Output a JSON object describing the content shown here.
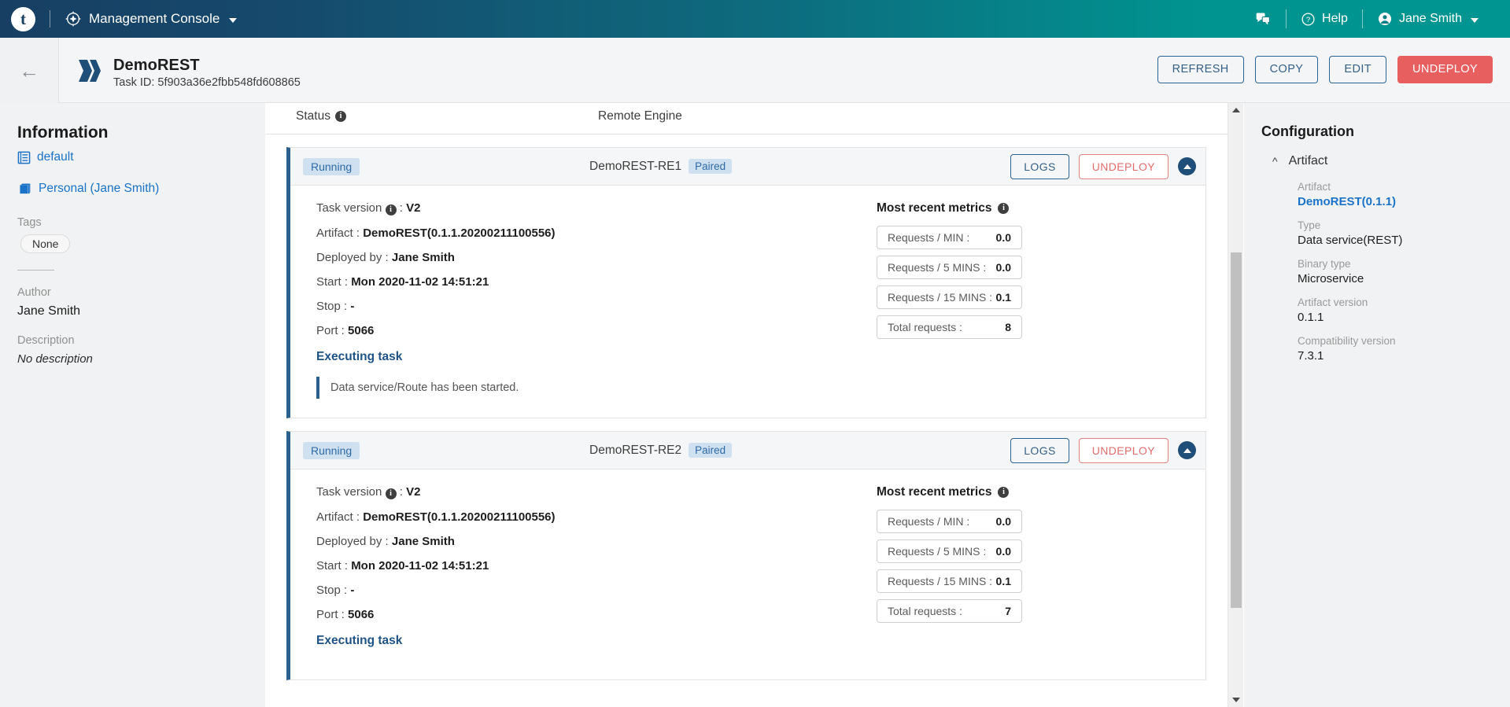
{
  "topbar": {
    "logo_letter": "t",
    "app_name": "Management Console",
    "app_icon": "compass-icon",
    "messages_icon": "chat-bubbles-icon",
    "help_icon": "question-circle-icon",
    "help_label": "Help",
    "user_icon": "user-avatar-icon",
    "user_name": "Jane Smith"
  },
  "pageheader": {
    "back_icon": "back-arrow-icon",
    "app_icon": "data-service-icon",
    "title": "DemoREST",
    "task_id": "Task ID: 5f903a36e2fbb548fd608865",
    "actions": {
      "refresh": "REFRESH",
      "copy": "COPY",
      "edit": "EDIT",
      "undeploy": "UNDEPLOY"
    }
  },
  "information": {
    "heading": "Information",
    "domain_icon": "list-document-icon",
    "domain": "default",
    "workspace_icon": "books-icon",
    "workspace": "Personal (Jane Smith)",
    "tags_label": "Tags",
    "tags_value": "None",
    "author_label": "Author",
    "author_value": "Jane Smith",
    "description_label": "Description",
    "description_value": "No description"
  },
  "table": {
    "col_status": "Status",
    "col_status_info_icon": "info-icon",
    "col_engine": "Remote Engine"
  },
  "cards": [
    {
      "status": "Running",
      "engine": "DemoREST-RE1",
      "pair_state": "Paired",
      "logs_label": "LOGS",
      "undeploy_label": "UNDEPLOY",
      "collapse_icon": "chevron-up-icon",
      "task_version_label": "Task version",
      "task_version_info_icon": "info-icon",
      "task_version_value": "V2",
      "artifact_label": "Artifact :",
      "artifact_value": "DemoREST(0.1.1.20200211100556)",
      "deployed_by_label": "Deployed by :",
      "deployed_by_value": "Jane Smith",
      "start_label": "Start :",
      "start_value": "Mon 2020-11-02 14:51:21",
      "stop_label": "Stop :",
      "stop_value": "-",
      "port_label": "Port :",
      "port_value": "5066",
      "executing_title": "Executing task",
      "executing_message": "Data service/Route has been started.",
      "metrics_title": "Most recent metrics",
      "metrics_info_icon": "info-icon",
      "metrics": [
        {
          "label": "Requests / MIN :",
          "value": "0.0"
        },
        {
          "label": "Requests / 5 MINS :",
          "value": "0.0"
        },
        {
          "label": "Requests / 15 MINS :",
          "value": "0.1"
        },
        {
          "label": "Total requests :",
          "value": "8"
        }
      ]
    },
    {
      "status": "Running",
      "engine": "DemoREST-RE2",
      "pair_state": "Paired",
      "logs_label": "LOGS",
      "undeploy_label": "UNDEPLOY",
      "collapse_icon": "chevron-up-icon",
      "task_version_label": "Task version",
      "task_version_info_icon": "info-icon",
      "task_version_value": "V2",
      "artifact_label": "Artifact :",
      "artifact_value": "DemoREST(0.1.1.20200211100556)",
      "deployed_by_label": "Deployed by :",
      "deployed_by_value": "Jane Smith",
      "start_label": "Start :",
      "start_value": "Mon 2020-11-02 14:51:21",
      "stop_label": "Stop :",
      "stop_value": "-",
      "port_label": "Port :",
      "port_value": "5066",
      "executing_title": "Executing task",
      "executing_message": "",
      "metrics_title": "Most recent metrics",
      "metrics_info_icon": "info-icon",
      "metrics": [
        {
          "label": "Requests / MIN :",
          "value": "0.0"
        },
        {
          "label": "Requests / 5 MINS :",
          "value": "0.0"
        },
        {
          "label": "Requests / 15 MINS :",
          "value": "0.1"
        },
        {
          "label": "Total requests :",
          "value": "7"
        }
      ]
    }
  ],
  "configuration": {
    "heading": "Configuration",
    "section_icon": "chevron-up-icon",
    "section_title": "Artifact",
    "fields": [
      {
        "label": "Artifact",
        "value": "DemoREST(0.1.1)",
        "is_link": true
      },
      {
        "label": "Type",
        "value": "Data service(REST)",
        "is_link": false
      },
      {
        "label": "Binary type",
        "value": "Microservice",
        "is_link": false
      },
      {
        "label": "Artifact version",
        "value": "0.1.1",
        "is_link": false
      },
      {
        "label": "Compatibility version",
        "value": "7.3.1",
        "is_link": false
      }
    ]
  },
  "colors": {
    "brand_navy": "#173f63",
    "brand_teal": "#009591",
    "accent_blue": "#1a73c8",
    "danger_red": "#e7605f",
    "card_left_bar": "#2b5f8c",
    "chip_blue_bg": "#cfe0f0",
    "chip_blue_fg": "#2e6aa5"
  }
}
